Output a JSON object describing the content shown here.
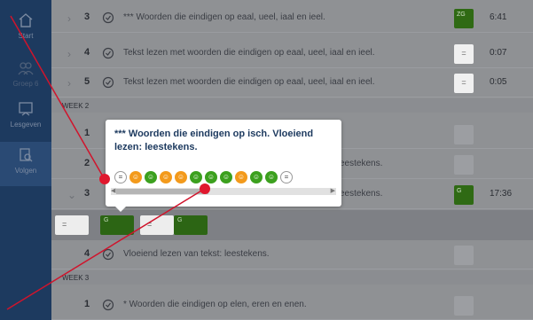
{
  "sidebar": {
    "items": [
      {
        "label": "Start",
        "icon": "home-icon"
      },
      {
        "label": "Groep 6",
        "icon": "group-icon"
      },
      {
        "label": "Lesgeven",
        "icon": "teach-icon"
      },
      {
        "label": "Volgen",
        "icon": "follow-icon"
      }
    ]
  },
  "rows": [
    {
      "num": "3",
      "title": "*** Woorden die eindigen op eaal, ueel, iaal en ieel.",
      "badge": "ZG",
      "time": "6:41"
    },
    {
      "num": "4",
      "title": "Tekst lezen met woorden die eindigen op eaal, ueel, iaal en ieel.",
      "badge": "=",
      "time": "0:07"
    },
    {
      "num": "5",
      "title": "Tekst lezen met woorden die eindigen op eaal, ueel, iaal en ieel.",
      "badge": "=",
      "time": "0:05"
    }
  ],
  "week2": {
    "label": "WEEK 2",
    "rows": [
      {
        "num": "1",
        "title": ""
      },
      {
        "num": "2",
        "title": "eestekens."
      },
      {
        "num": "3",
        "title": "eestekens.",
        "badge": "G",
        "time": "17:36"
      },
      {
        "num": "4",
        "title": "Vloeiend lezen van tekst: leestekens."
      }
    ]
  },
  "expand": {
    "items": [
      {
        "type": "white",
        "label": "="
      },
      {
        "type": "green",
        "label": "G"
      },
      {
        "type": "white",
        "label": "="
      },
      {
        "type": "green",
        "label": "G"
      }
    ]
  },
  "week3": {
    "label": "WEEK 3",
    "rows": [
      {
        "num": "1",
        "title": "* Woorden die eindigen op elen, eren en enen."
      }
    ]
  },
  "popover": {
    "title": "*** Woorden die eindigen op isch. Vloeiend lezen: leestekens.",
    "circles": [
      "white",
      "orange",
      "green",
      "orange",
      "orange",
      "green",
      "green",
      "green",
      "orange",
      "green",
      "green",
      "white"
    ]
  },
  "colors": {
    "sidebar": "#1d3a5f",
    "green": "#3ca01e",
    "orange": "#f39a1c",
    "annotation": "#d0142c"
  }
}
